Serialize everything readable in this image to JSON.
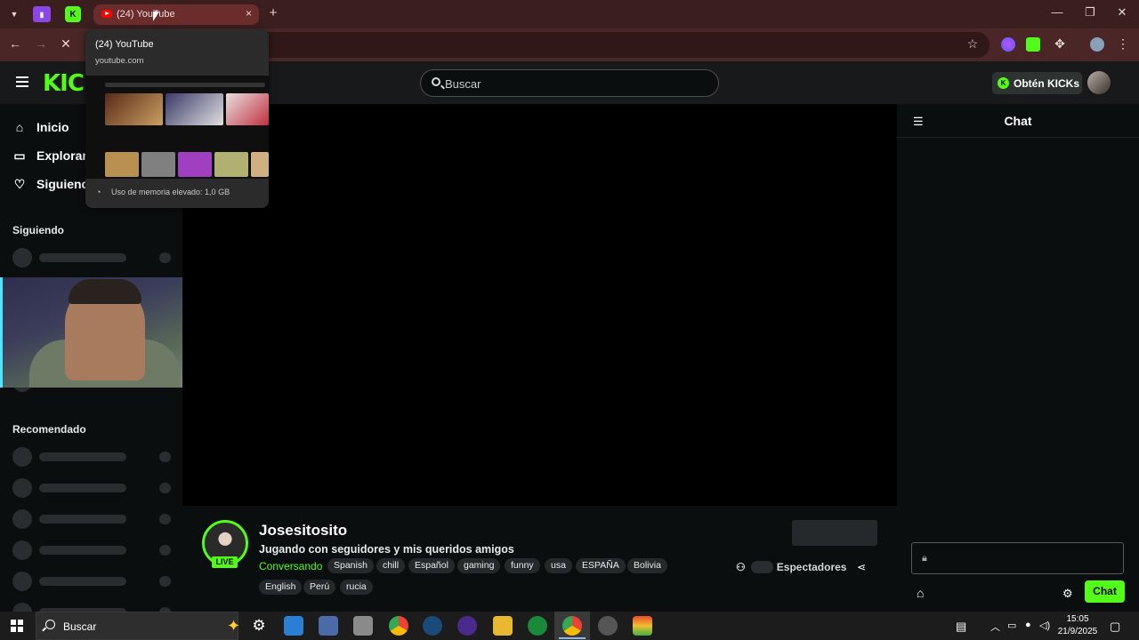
{
  "browser": {
    "active_tab_title": "(24) YouTube",
    "tab_close": "×",
    "new_tab": "+",
    "win_minimize": "—",
    "win_restore": "❐",
    "win_close": "✕"
  },
  "tab_preview": {
    "title": "(24) YouTube",
    "url": "youtube.com",
    "memory": "Uso de memoria elevado: 1,0 GB"
  },
  "kick": {
    "logo": "KICK",
    "search_placeholder": "Buscar",
    "kicks_button": "Obtén KICKs",
    "kicks_coin": "K",
    "sidebar": {
      "nav": [
        {
          "label": "Inicio",
          "icon": "home-icon"
        },
        {
          "label": "Explorar",
          "icon": "compass-icon"
        },
        {
          "label": "Siguiendo",
          "icon": "heart-icon"
        }
      ],
      "following_header": "Siguiendo",
      "recommended_header": "Recomendado"
    },
    "chat": {
      "title": "Chat",
      "send_button": "Chat"
    },
    "stream": {
      "streamer": "Josesitosito",
      "live_badge": "LIVE",
      "title": "Jugando con seguidores y mis queridos amigos",
      "category": "Conversando",
      "tags": [
        "Spanish",
        "chill",
        "Español",
        "gaming",
        "funny",
        "usa",
        "ESPAÑA",
        "Bolivia",
        "English",
        "Perú",
        "rucia"
      ],
      "viewers_label": "Espectadores"
    }
  },
  "taskbar": {
    "search": "Buscar",
    "time": "15:05",
    "date": "21/9/2025"
  },
  "colors": {
    "kick_green": "#53fc18",
    "browser_frame": "#3b1e1e",
    "highlight": "#4de6ff"
  }
}
